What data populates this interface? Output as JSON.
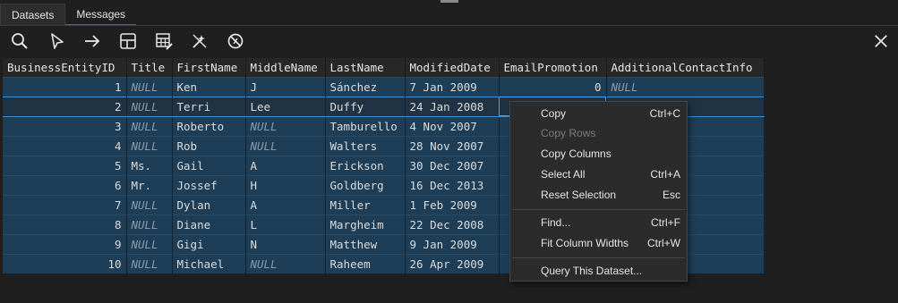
{
  "tabs": [
    {
      "label": "Datasets"
    },
    {
      "label": "Messages"
    }
  ],
  "toolbar": {
    "icons": [
      "search-icon",
      "select-pointer-icon",
      "arrow-right-icon",
      "table-layout-icon",
      "table-edit-icon",
      "clear-filter-icon",
      "cancel-icon"
    ]
  },
  "grid": {
    "columns": [
      "BusinessEntityID",
      "Title",
      "FirstName",
      "MiddleName",
      "LastName",
      "ModifiedDate",
      "EmailPromotion",
      "AdditionalContactInfo"
    ],
    "rows": [
      [
        "1",
        "NULL",
        "Ken",
        "J",
        "Sánchez",
        "7 Jan 2009",
        "0",
        "NULL"
      ],
      [
        "2",
        "NULL",
        "Terri",
        "Lee",
        "Duffy",
        "24 Jan 2008",
        "",
        ""
      ],
      [
        "3",
        "NULL",
        "Roberto",
        "NULL",
        "Tamburello",
        "4 Nov 2007",
        "",
        ""
      ],
      [
        "4",
        "NULL",
        "Rob",
        "NULL",
        "Walters",
        "28 Nov 2007",
        "",
        ""
      ],
      [
        "5",
        "Ms.",
        "Gail",
        "A",
        "Erickson",
        "30 Dec 2007",
        "",
        ""
      ],
      [
        "6",
        "Mr.",
        "Jossef",
        "H",
        "Goldberg",
        "16 Dec 2013",
        "",
        ""
      ],
      [
        "7",
        "NULL",
        "Dylan",
        "A",
        "Miller",
        "1 Feb 2009",
        "",
        ""
      ],
      [
        "8",
        "NULL",
        "Diane",
        "L",
        "Margheim",
        "22 Dec 2008",
        "",
        ""
      ],
      [
        "9",
        "NULL",
        "Gigi",
        "N",
        "Matthew",
        "9 Jan 2009",
        "",
        ""
      ],
      [
        "10",
        "NULL",
        "Michael",
        "NULL",
        "Raheem",
        "26 Apr 2009",
        "",
        ""
      ]
    ]
  },
  "context_menu": {
    "items": [
      {
        "label": "Copy",
        "shortcut": "Ctrl+C"
      },
      {
        "label": "Copy Rows",
        "shortcut": ""
      },
      {
        "label": "Copy Columns",
        "shortcut": ""
      },
      {
        "label": "Select All",
        "shortcut": "Ctrl+A"
      },
      {
        "label": "Reset Selection",
        "shortcut": "Esc"
      },
      {
        "label": "Find...",
        "shortcut": "Ctrl+F"
      },
      {
        "label": "Fit Column Widths",
        "shortcut": "Ctrl+W"
      },
      {
        "label": "Query This Dataset...",
        "shortcut": ""
      }
    ]
  }
}
